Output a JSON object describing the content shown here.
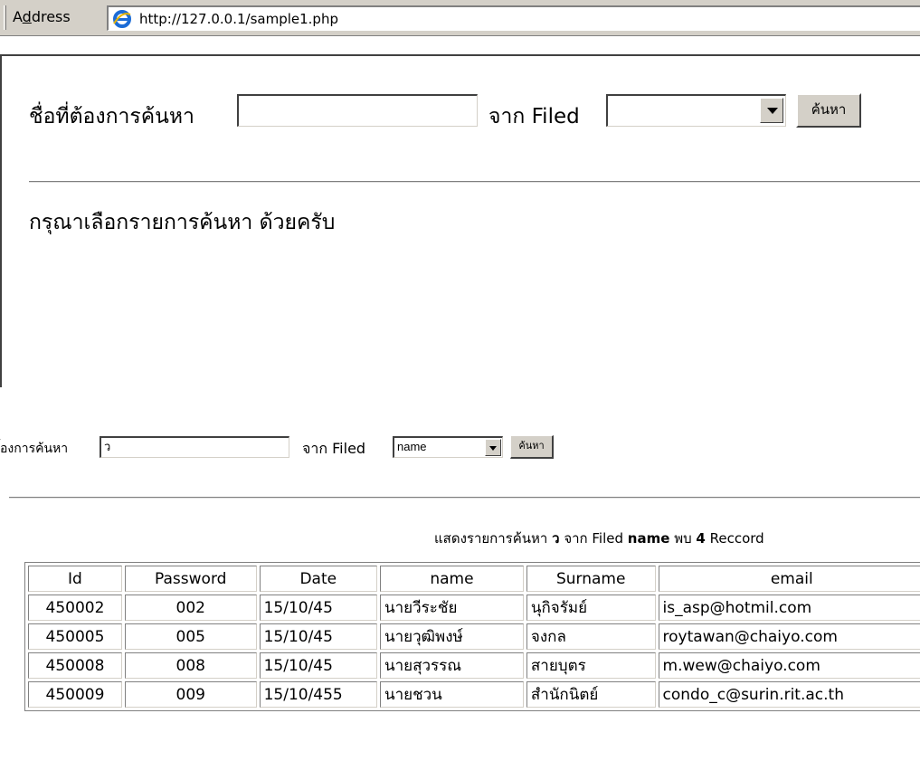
{
  "browser": {
    "address_label_prefix": "A",
    "address_label_underlined": "d",
    "address_label_suffix": "dress",
    "url": "http://127.0.0.1/sample1.php"
  },
  "form_top": {
    "search_label": "ชื่อที่ต้องการค้นหา",
    "search_value": "",
    "from_label": "จาก Filed",
    "field_selected": "",
    "search_button": "ค้นหา",
    "message": "กรุณาเลือกรายการค้นหา ด้วยครับ"
  },
  "form_bottom": {
    "search_label": "้องการค้นหา",
    "search_value": "ว",
    "from_label": "จาก Filed",
    "field_selected": "name",
    "search_button": "ค้นหา"
  },
  "result_summary": {
    "prefix": "แสดงรายการค้นหา",
    "keyword": "ว",
    "from": "จาก Filed",
    "field": "name",
    "found": "พบ",
    "count": "4",
    "unit": "Reccord"
  },
  "table": {
    "headers": [
      "Id",
      "Password",
      "Date",
      "name",
      "Surname",
      "email"
    ],
    "rows": [
      [
        "450002",
        "002",
        "15/10/45",
        "นายวีระชัย",
        "นุกิจรัมย์",
        "is_asp@hotmil.com"
      ],
      [
        "450005",
        "005",
        "15/10/45",
        "นายวุฒิพงษ์",
        "จงกล",
        "roytawan@chaiyo.com"
      ],
      [
        "450008",
        "008",
        "15/10/45",
        "นายสุวรรณ",
        "สายบุตร",
        "m.wew@chaiyo.com"
      ],
      [
        "450009",
        "009",
        "15/10/455",
        "นายชวน",
        "สำนักนิตย์",
        "condo_c@surin.rit.ac.th"
      ]
    ]
  }
}
